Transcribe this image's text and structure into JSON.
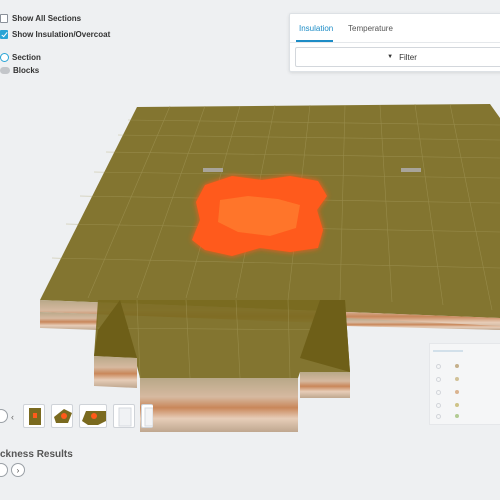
{
  "controls": {
    "show_all_sections": {
      "label": "Show All Sections",
      "checked": false
    },
    "show_insulation_overcoat": {
      "label": "Show Insulation/Overcoat",
      "checked": true
    },
    "section": {
      "label": "Section",
      "selected": true
    },
    "blocks": {
      "label": "Blocks",
      "enabled": false
    }
  },
  "panel": {
    "tabs": [
      {
        "label": "Insulation",
        "active": true
      },
      {
        "label": "Temperature",
        "active": false
      }
    ],
    "filter": {
      "label": "Filter",
      "icon": "caret-down-icon"
    }
  },
  "viewer": {
    "colors": {
      "slab_top": "#7a6a1f",
      "slab_side": "#8f7d33",
      "hot_spot": "#ff5a1a",
      "grid": "#a59a5c"
    }
  },
  "thumbnails": [
    {
      "name": "thumbnail-1"
    },
    {
      "name": "thumbnail-2"
    },
    {
      "name": "thumbnail-3"
    },
    {
      "name": "thumbnail-4"
    },
    {
      "name": "thumbnail-5"
    }
  ],
  "results": {
    "title": "ckness Results"
  }
}
